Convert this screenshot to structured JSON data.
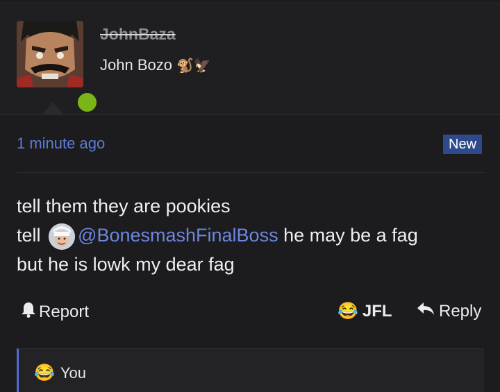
{
  "post": {
    "username": "JohnBaza",
    "user_title": "John Bozo",
    "user_title_emoji": "🐒🦅",
    "time": "1 minute ago",
    "badge": "New",
    "body_line1": "tell them they are pookies",
    "body_line2_prefix": "tell",
    "mention": "@BonesmashFinalBoss",
    "body_line2_suffix": " he may be a fag",
    "body_line3": "but he is lowk my dear fag"
  },
  "actions": {
    "report_label": "Report",
    "reaction_label": "JFL",
    "reaction_emoji": "😂",
    "reply_label": "Reply"
  },
  "reactions": {
    "emoji": "😂",
    "label": "You"
  },
  "colors": {
    "status_online": "#7cb518",
    "link": "#6d86e0",
    "badge": "#2f4a8a"
  }
}
